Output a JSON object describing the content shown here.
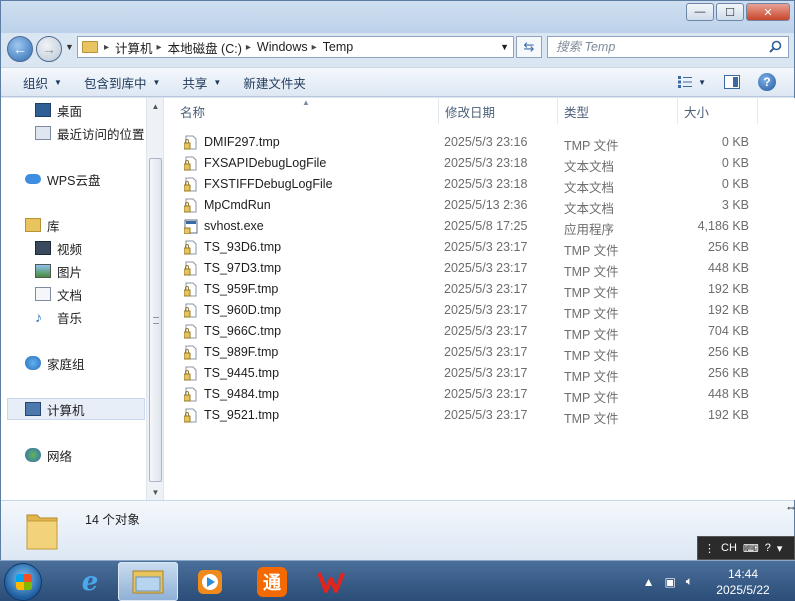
{
  "window": {
    "controls": {
      "minimize": "—",
      "maximize": "☐",
      "close": "✕"
    }
  },
  "address": {
    "crumbs": [
      "计算机",
      "本地磁盘 (C:)",
      "Windows",
      "Temp"
    ]
  },
  "search": {
    "placeholder": "搜索 Temp"
  },
  "toolbar": {
    "organize": "组织",
    "include_library": "包含到库中",
    "share": "共享",
    "new_folder": "新建文件夹"
  },
  "navpane": {
    "items": [
      {
        "label": "桌面",
        "icon": "desktop-icon"
      },
      {
        "label": "最近访问的位置",
        "icon": "recent-places-icon"
      },
      {
        "label": "WPS云盘",
        "icon": "cloud-icon"
      },
      {
        "label": "库",
        "icon": "library-icon"
      },
      {
        "label": "视频",
        "icon": "video-icon"
      },
      {
        "label": "图片",
        "icon": "pictures-icon"
      },
      {
        "label": "文档",
        "icon": "documents-icon"
      },
      {
        "label": "音乐",
        "icon": "music-icon"
      },
      {
        "label": "家庭组",
        "icon": "homegroup-icon"
      },
      {
        "label": "计算机",
        "icon": "computer-icon"
      },
      {
        "label": "网络",
        "icon": "network-icon"
      }
    ]
  },
  "columns": {
    "name": "名称",
    "date": "修改日期",
    "type": "类型",
    "size": "大小"
  },
  "files": [
    {
      "name": "DMIF297.tmp",
      "date": "2025/5/3 23:16",
      "type": "TMP 文件",
      "size": "0 KB",
      "icon": "lock-file-icon"
    },
    {
      "name": "FXSAPIDebugLogFile",
      "date": "2025/5/3 23:18",
      "type": "文本文档",
      "size": "0 KB",
      "icon": "lock-file-icon"
    },
    {
      "name": "FXSTIFFDebugLogFile",
      "date": "2025/5/3 23:18",
      "type": "文本文档",
      "size": "0 KB",
      "icon": "lock-file-icon"
    },
    {
      "name": "MpCmdRun",
      "date": "2025/5/13 2:36",
      "type": "文本文档",
      "size": "3 KB",
      "icon": "lock-file-icon"
    },
    {
      "name": "svhost.exe",
      "date": "2025/5/8 17:25",
      "type": "应用程序",
      "size": "4,186 KB",
      "icon": "exe-file-icon"
    },
    {
      "name": "TS_93D6.tmp",
      "date": "2025/5/3 23:17",
      "type": "TMP 文件",
      "size": "256 KB",
      "icon": "lock-file-icon"
    },
    {
      "name": "TS_97D3.tmp",
      "date": "2025/5/3 23:17",
      "type": "TMP 文件",
      "size": "448 KB",
      "icon": "lock-file-icon"
    },
    {
      "name": "TS_959F.tmp",
      "date": "2025/5/3 23:17",
      "type": "TMP 文件",
      "size": "192 KB",
      "icon": "lock-file-icon"
    },
    {
      "name": "TS_960D.tmp",
      "date": "2025/5/3 23:17",
      "type": "TMP 文件",
      "size": "192 KB",
      "icon": "lock-file-icon"
    },
    {
      "name": "TS_966C.tmp",
      "date": "2025/5/3 23:17",
      "type": "TMP 文件",
      "size": "704 KB",
      "icon": "lock-file-icon"
    },
    {
      "name": "TS_989F.tmp",
      "date": "2025/5/3 23:17",
      "type": "TMP 文件",
      "size": "256 KB",
      "icon": "lock-file-icon"
    },
    {
      "name": "TS_9445.tmp",
      "date": "2025/5/3 23:17",
      "type": "TMP 文件",
      "size": "256 KB",
      "icon": "lock-file-icon"
    },
    {
      "name": "TS_9484.tmp",
      "date": "2025/5/3 23:17",
      "type": "TMP 文件",
      "size": "448 KB",
      "icon": "lock-file-icon"
    },
    {
      "name": "TS_9521.tmp",
      "date": "2025/5/3 23:17",
      "type": "TMP 文件",
      "size": "192 KB",
      "icon": "lock-file-icon"
    }
  ],
  "status": {
    "count": "14 个对象"
  },
  "ime": {
    "lang": "CH"
  },
  "taskbar": {
    "clock_time": "14:44",
    "clock_date": "2025/5/22"
  }
}
